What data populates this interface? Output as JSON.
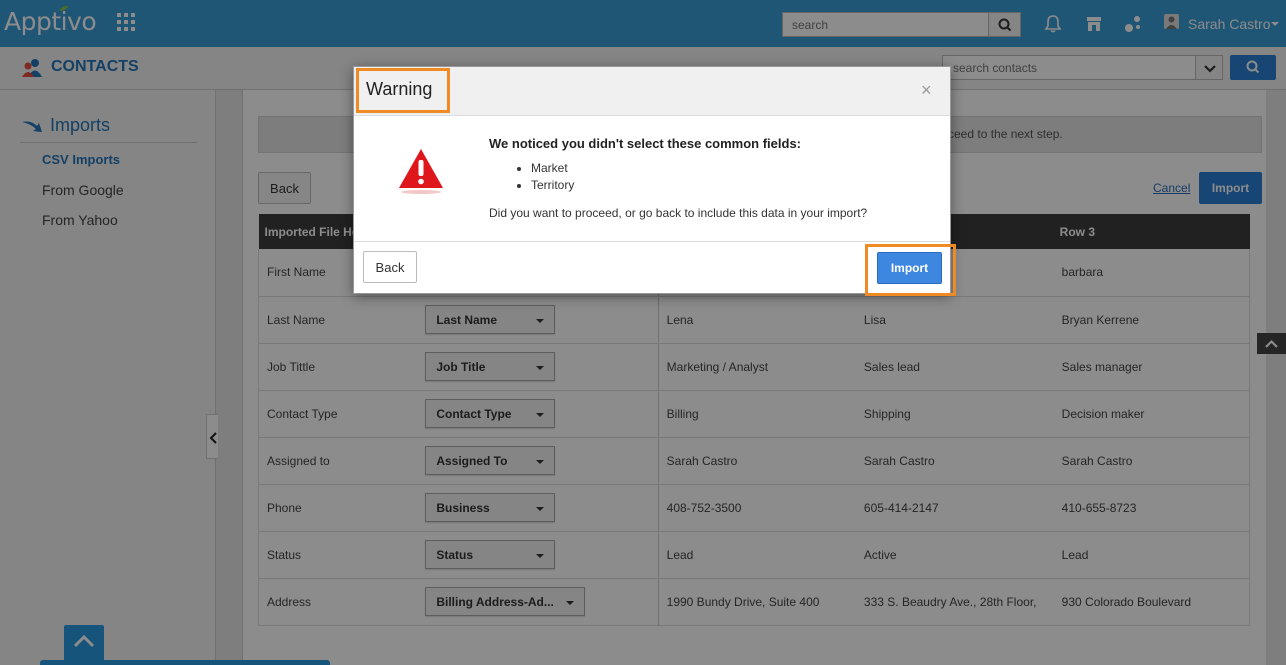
{
  "topbar": {
    "logo": "Apptivo",
    "search_placeholder": "search",
    "user_name": "Sarah Castro"
  },
  "subbar": {
    "title": "CONTACTS",
    "search_placeholder": "search contacts"
  },
  "sidebar": {
    "title": "Imports",
    "items": [
      {
        "label": "CSV Imports",
        "active": true
      },
      {
        "label": "From Google",
        "active": false
      },
      {
        "label": "From Yahoo",
        "active": false
      }
    ]
  },
  "main": {
    "notice_text": "ceed to the next step.",
    "back_label": "Back",
    "cancel_label": "Cancel",
    "import_label": "Import",
    "table": {
      "headers": [
        "Imported File He",
        "",
        "",
        "",
        "Row 3"
      ],
      "rows": [
        {
          "field": "First Name",
          "mapping": "",
          "r1": "",
          "r2": "",
          "r3": "barbara"
        },
        {
          "field": "Last Name",
          "mapping": "Last Name",
          "r1": "Lena",
          "r2": "Lisa",
          "r3": "Bryan Kerrene"
        },
        {
          "field": "Job Tittle",
          "mapping": "Job Title",
          "r1": "Marketing / Analyst",
          "r2": "Sales lead",
          "r3": "Sales manager"
        },
        {
          "field": "Contact Type",
          "mapping": "Contact Type",
          "r1": "Billing",
          "r2": "Shipping",
          "r3": "Decision maker"
        },
        {
          "field": "Assigned to",
          "mapping": "Assigned To",
          "r1": "Sarah Castro",
          "r2": "Sarah Castro",
          "r3": "Sarah Castro"
        },
        {
          "field": "Phone",
          "mapping": "Business",
          "r1": "408-752-3500",
          "r2": "605-414-2147",
          "r3": "410-655-8723"
        },
        {
          "field": "Status",
          "mapping": "Status",
          "r1": "Lead",
          "r2": "Active",
          "r3": "Lead"
        },
        {
          "field": "Address",
          "mapping": "Billing Address-Ad...",
          "r1": "1990 Bundy Drive, Suite 400",
          "r2": "333 S. Beaudry Ave., 28th Floor,",
          "r3": "930 Colorado Boulevard"
        }
      ]
    }
  },
  "modal": {
    "title": "Warning",
    "close": "×",
    "message": "We noticed you didn't select these common fields:",
    "fields": [
      "Market",
      "Territory"
    ],
    "question": "Did you want to proceed, or go back to include this data in your import?",
    "back_label": "Back",
    "import_label": "Import"
  },
  "colors": {
    "brand_blue": "#3a9bd5",
    "button_blue": "#2b7fd4",
    "highlight_orange": "#f08a24",
    "warning_red": "#e0161d"
  }
}
